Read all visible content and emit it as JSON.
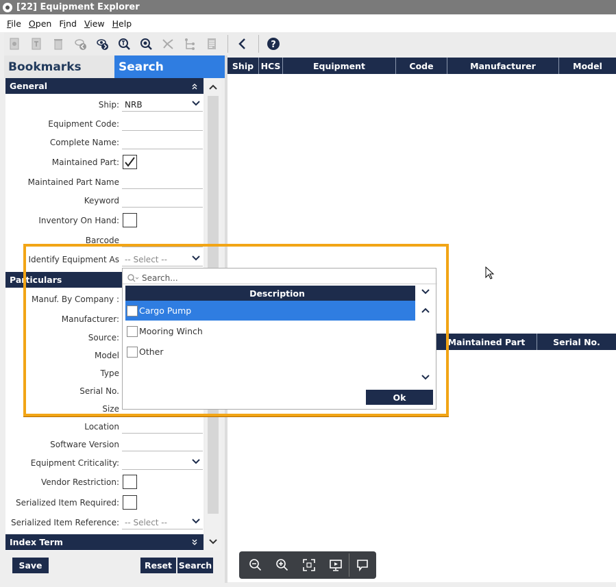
{
  "window": {
    "title": "[22] Equipment Explorer"
  },
  "menu": {
    "items": [
      "File",
      "Open",
      "Find",
      "View",
      "Help"
    ],
    "underlines": [
      "F",
      "O",
      "i",
      "V",
      "H"
    ]
  },
  "toolbar": {
    "icons": [
      "new-record-icon",
      "copy-record-icon",
      "delete-icon",
      "hide-icon",
      "show-icon",
      "search-icon",
      "search-settings-icon",
      "tree-icon",
      "hierarchy-icon",
      "report-icon",
      "back-icon",
      "help-icon"
    ]
  },
  "tabs": {
    "bookmarks": "Bookmarks",
    "search": "Search"
  },
  "sections": {
    "general": "General",
    "particulars": "Particulars",
    "index_term": "Index Term"
  },
  "fields": {
    "ship": {
      "label": "Ship:",
      "value": "NRB"
    },
    "equipment_code": {
      "label": "Equipment Code:"
    },
    "complete_name": {
      "label": "Complete Name:"
    },
    "maintained_part": {
      "label": "Maintained Part:",
      "checked": true
    },
    "maintained_part_name": {
      "label": "Maintained Part Name"
    },
    "keyword": {
      "label": "Keyword"
    },
    "inventory_on_hand": {
      "label": "Inventory On Hand:",
      "checked": false
    },
    "barcode": {
      "label": "Barcode"
    },
    "identify_equipment_as": {
      "label": "Identify Equipment As",
      "value": "-- Select --"
    },
    "manuf_by_company": {
      "label": "Manuf. By Company :"
    },
    "manufacturer": {
      "label": "Manufacturer:"
    },
    "source": {
      "label": "Source:"
    },
    "model": {
      "label": "Model"
    },
    "type": {
      "label": "Type"
    },
    "serial_no": {
      "label": "Serial No."
    },
    "size": {
      "label": "Size"
    },
    "location": {
      "label": "Location"
    },
    "software_version": {
      "label": "Software Version"
    },
    "equipment_criticality": {
      "label": "Equipment Criticality:"
    },
    "vendor_restriction": {
      "label": "Vendor Restriction:",
      "checked": false
    },
    "serialized_item_required": {
      "label": "Serialized Item Required:",
      "checked": false
    },
    "serialized_item_reference": {
      "label": "Serialized Item Reference:",
      "value": "-- Select --"
    }
  },
  "buttons": {
    "save": "Save",
    "reset": "Reset",
    "search": "Search",
    "ok": "Ok"
  },
  "grid": {
    "columns": [
      "Ship",
      "HCS",
      "Equipment",
      "Code",
      "Manufacturer",
      "Model"
    ],
    "sub_columns": [
      "Maintained Part",
      "Serial No."
    ]
  },
  "dropdown": {
    "search_placeholder": "Search...",
    "header": "Description",
    "options": [
      "Cargo Pump",
      "Mooring Winch",
      "Other"
    ],
    "selected": "Cargo Pump"
  },
  "colors": {
    "navy": "#1d2c4c",
    "accent_blue": "#2f7de1",
    "highlight": "#f2a516"
  }
}
